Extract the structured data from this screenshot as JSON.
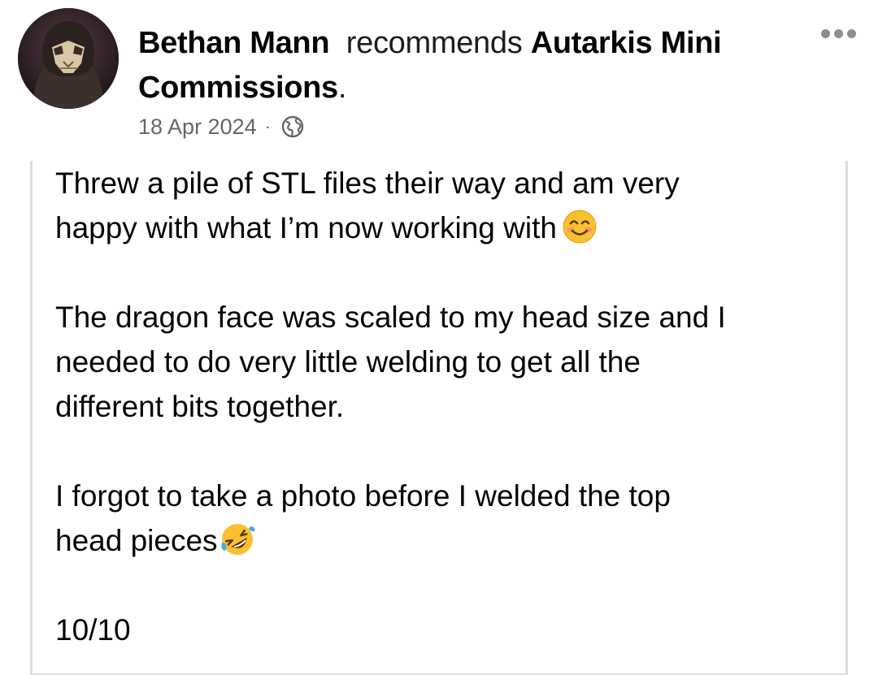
{
  "post": {
    "author": "Bethan Mann",
    "action": "recommends",
    "page_name_line1": "Autarkis Mini",
    "page_name_line2": "Commissions",
    "period": ".",
    "date": "18 Apr 2024",
    "separator": "·",
    "privacy_icon": "globe-icon",
    "more_icon": "more-options-icon"
  },
  "review": {
    "para1_line1": "Threw a pile of STL files their way and am very",
    "para1_line2": "happy with what I’m now working with",
    "para1_emoji": "smiling-face-emoji",
    "para2_line1": "The dragon face was scaled to my head size and I",
    "para2_line2": "needed to do very little welding to get all the",
    "para2_line3": "different bits together.",
    "para3_line1": "I forgot to take a photo before I welded the top",
    "para3_line2": "head pieces",
    "para3_emoji": "rolling-on-floor-laughing-emoji",
    "rating": "10/10"
  },
  "colors": {
    "text": "#050505",
    "meta": "#65676b",
    "border": "#dcdde0"
  }
}
